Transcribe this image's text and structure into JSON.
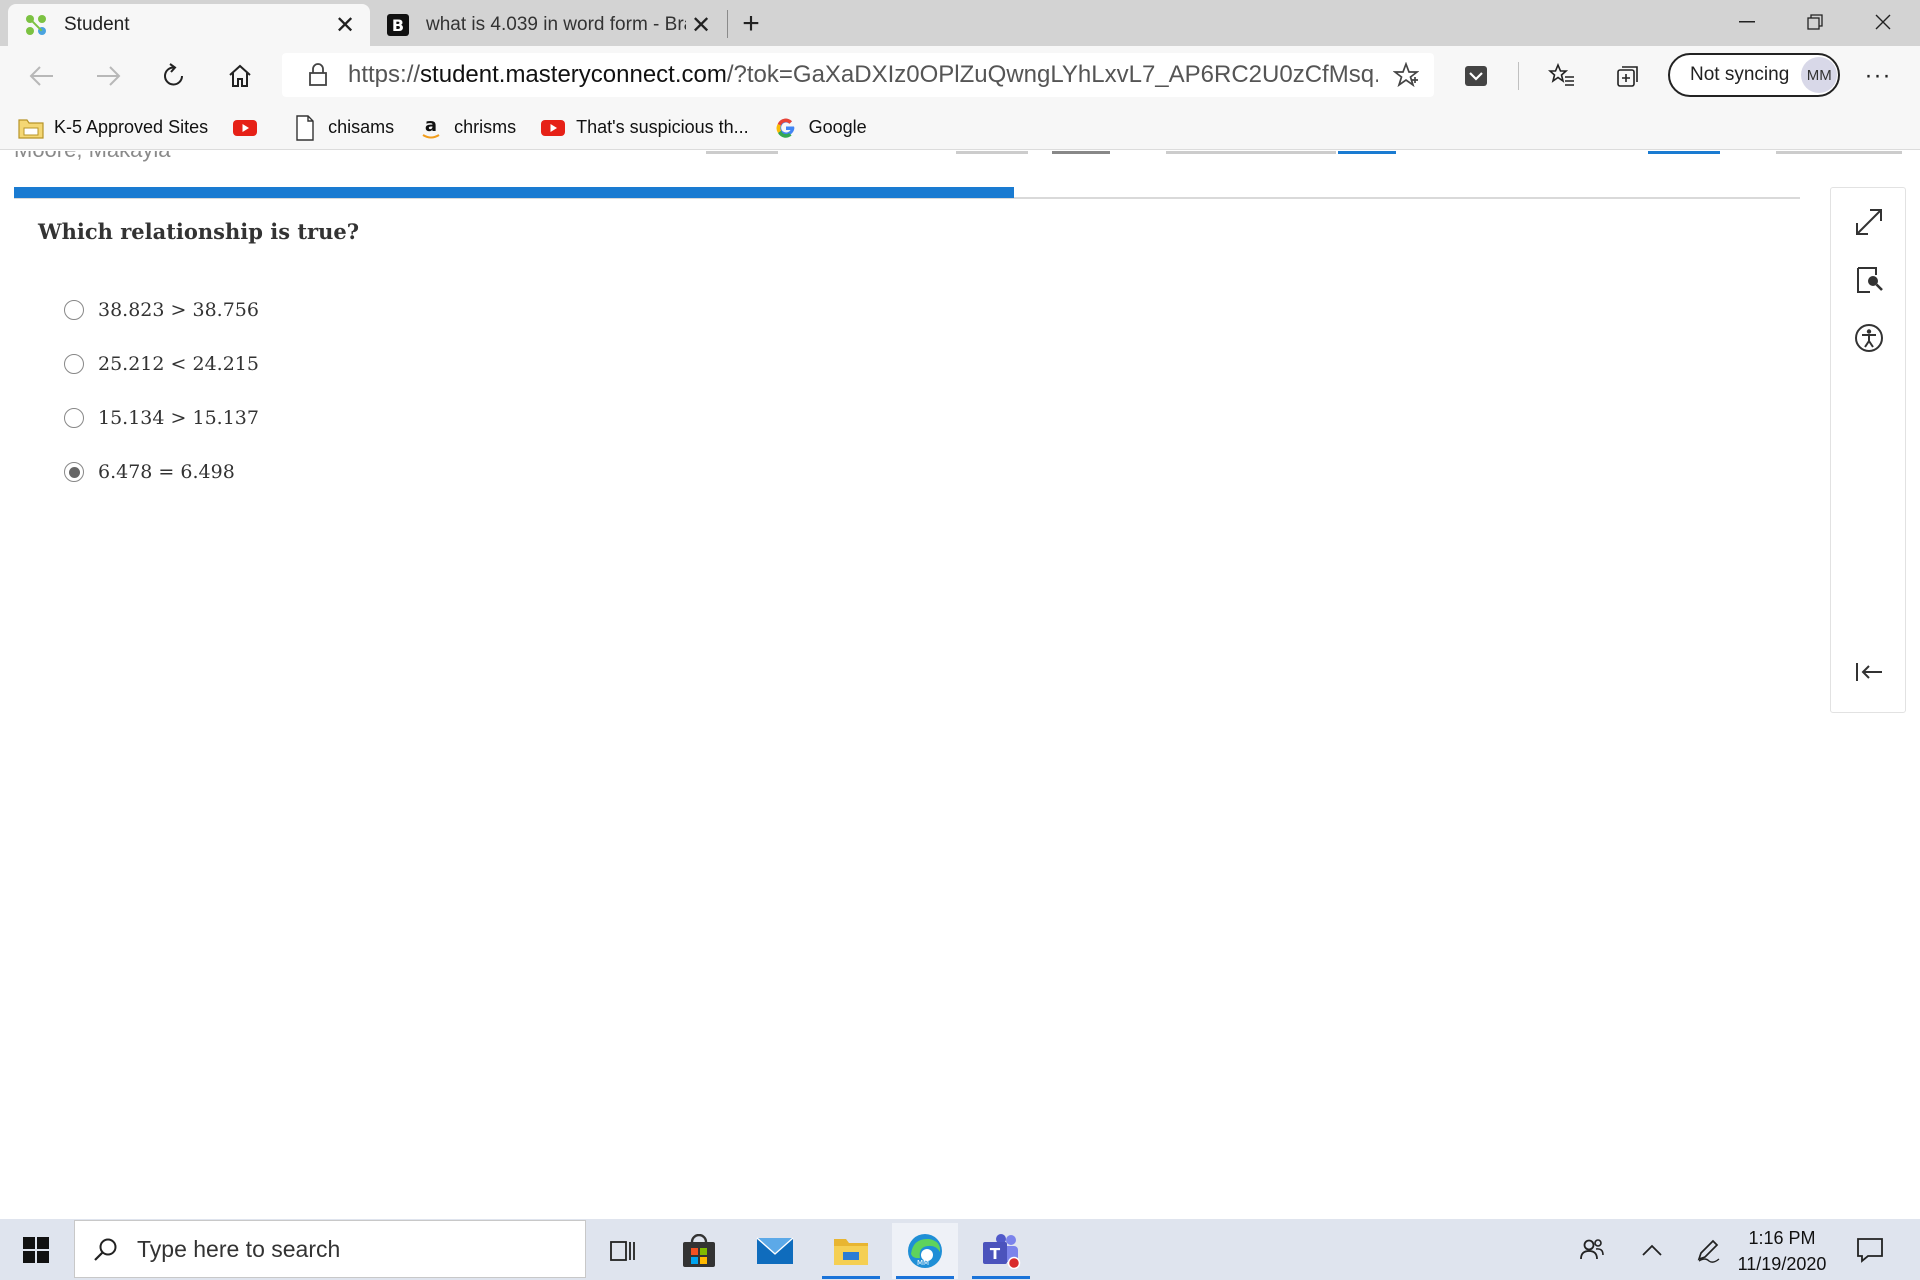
{
  "browser": {
    "tabs": [
      {
        "title": "Student",
        "favicon": "masteryconnect-icon",
        "active": true
      },
      {
        "title": "what is 4.039 in word form - Brai",
        "favicon": "brainly-icon",
        "active": false
      }
    ],
    "new_tab_icon": "plus-icon",
    "window_controls": [
      "minimize-icon",
      "restore-icon",
      "close-icon"
    ],
    "nav": {
      "back_icon": "back-arrow-icon",
      "forward_icon": "forward-arrow-icon",
      "refresh_icon": "refresh-icon",
      "home_icon": "home-icon"
    },
    "address": {
      "prefix": "https://",
      "domain": "student.masteryconnect.com",
      "path": "/?tok=GaXaDXIz0OPlZuQwngLYhLxvL7_AP6RC2U0zCfMsq..."
    },
    "toolbar_icons": [
      "favorite-star-icon",
      "pocket-icon",
      "favorites-list-icon",
      "collections-icon"
    ],
    "profile": {
      "label": "Not syncing",
      "initials": "MM"
    },
    "more_icon": "more-dots-icon"
  },
  "bookmarks": [
    {
      "label": "K-5 Approved Sites",
      "icon": "folder-icon"
    },
    {
      "label": "",
      "icon": "youtube-icon"
    },
    {
      "label": "chisams",
      "icon": "page-icon"
    },
    {
      "label": "chrisms",
      "icon": "amazon-icon"
    },
    {
      "label": "That's suspicious th...",
      "icon": "youtube-icon"
    },
    {
      "label": "Google",
      "icon": "google-icon"
    }
  ],
  "assessment": {
    "student_name": "Moore, Makayla",
    "progress_fraction": 0.56,
    "colors": {
      "progress": "#1a7bd1"
    },
    "question": "Which relationship is true?",
    "answers": [
      {
        "label": "38.823 > 38.756",
        "selected": false
      },
      {
        "label": "25.212 < 24.215",
        "selected": false
      },
      {
        "label": "15.134 > 15.137",
        "selected": false
      },
      {
        "label": "6.478 = 6.498",
        "selected": true
      }
    ],
    "side_tools": [
      "expand-icon",
      "magnifier-icon",
      "accessibility-icon",
      "collapse-panel-icon"
    ]
  },
  "taskbar": {
    "search_placeholder": "Type here to search",
    "apps": [
      "task-view-icon",
      "store-icon",
      "mail-icon",
      "file-explorer-icon",
      "edge-icon",
      "teams-icon"
    ],
    "tray_icons": [
      "people-icon",
      "chevron-up-icon",
      "pen-icon"
    ],
    "time": "1:16 PM",
    "date": "11/19/2020",
    "notification_icon": "notification-icon"
  }
}
